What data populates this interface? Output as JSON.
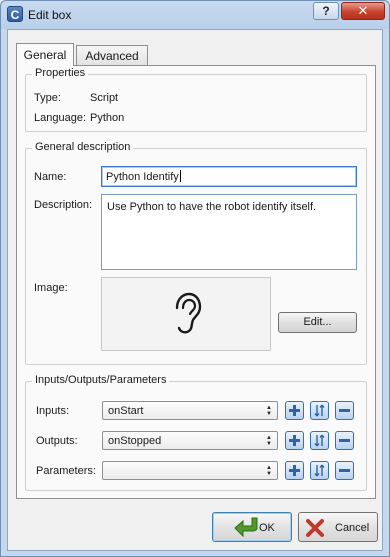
{
  "window": {
    "app_icon_letter": "C",
    "title": "Edit box",
    "help_label": "?",
    "close_label": "✕"
  },
  "tabs": [
    {
      "label": "General",
      "active": true
    },
    {
      "label": "Advanced",
      "active": false
    }
  ],
  "properties": {
    "title": "Properties",
    "type_label": "Type:",
    "type_value": "Script",
    "language_label": "Language:",
    "language_value": "Python"
  },
  "general_description": {
    "title": "General description",
    "name_label": "Name:",
    "name_value": "Python Identify",
    "description_label": "Description:",
    "description_value": "Use Python to have the robot identify itself.",
    "image_label": "Image:",
    "image_icon": "ear-icon",
    "edit_label": "Edit..."
  },
  "io": {
    "title": "Inputs/Outputs/Parameters",
    "rows": [
      {
        "label": "Inputs:",
        "value": "onStart"
      },
      {
        "label": "Outputs:",
        "value": "onStopped"
      },
      {
        "label": "Parameters:",
        "value": ""
      }
    ]
  },
  "buttons": {
    "ok_label": "OK",
    "cancel_label": "Cancel"
  },
  "colors": {
    "accent": "#3d7bc8",
    "ok_arrow": "#4e9a2a",
    "cancel_x": "#c0392b",
    "close_button": "#c8432d"
  }
}
